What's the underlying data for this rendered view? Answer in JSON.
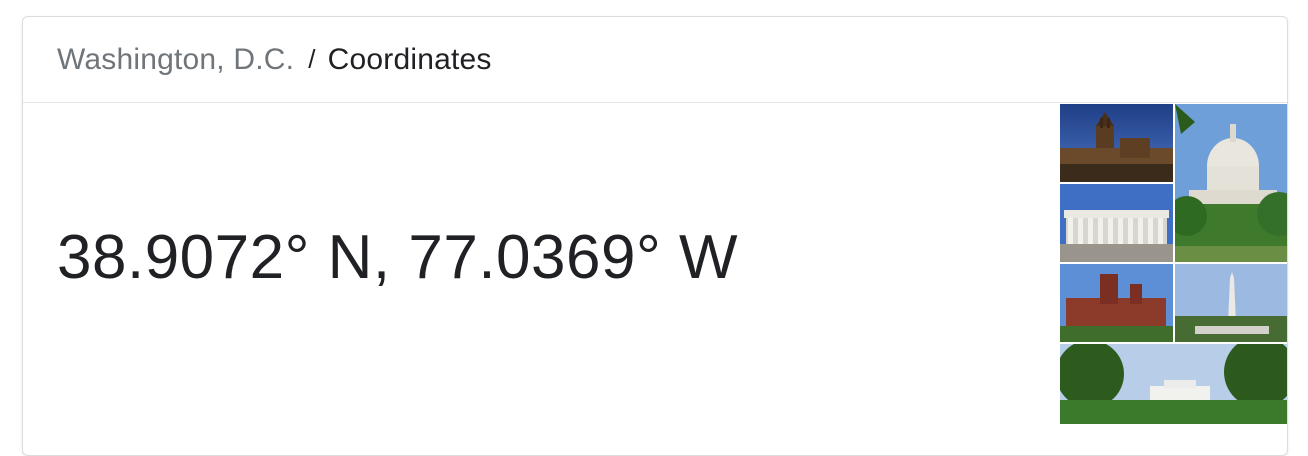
{
  "breadcrumb": {
    "parent": "Washington, D.C.",
    "separator": "/",
    "current": "Coordinates"
  },
  "answer": {
    "coordinates": "38.9072° N, 77.0369° W"
  },
  "collage": {
    "tiles": [
      "cathedral-photo",
      "capitol-photo",
      "lincoln-memorial-photo",
      "smithsonian-castle-photo",
      "washington-monument-photo",
      "white-house-photo"
    ]
  }
}
